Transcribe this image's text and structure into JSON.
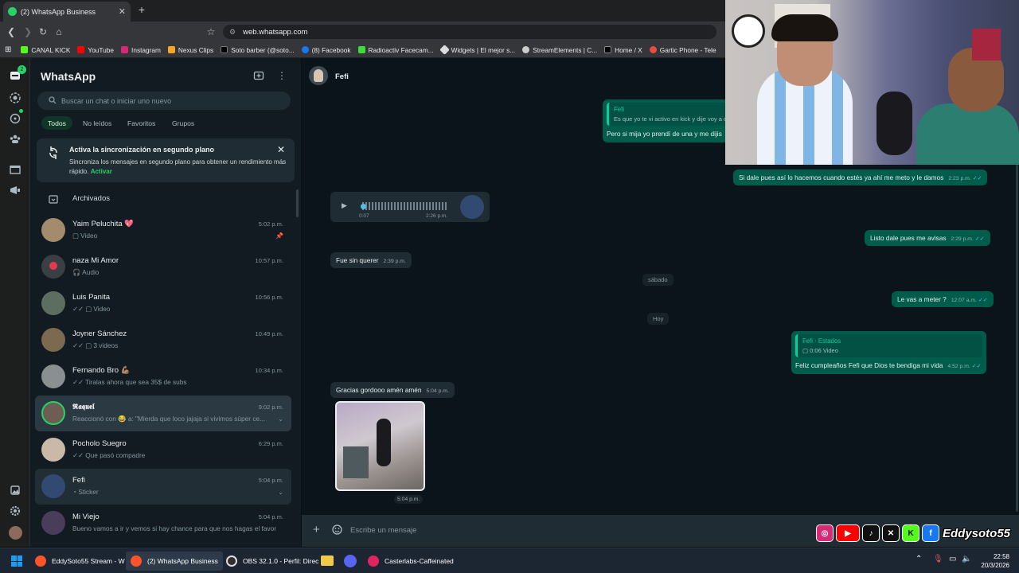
{
  "browser": {
    "tab_title": "(2) WhatsApp Business",
    "url": "web.whatsapp.com",
    "bookmarks": [
      "CANAL KICK",
      "YouTube",
      "Instagram",
      "Nexus Clips",
      "Soto barber (@soto...",
      "(8) Facebook",
      "Radioactiv Facecam...",
      "Widgets | El mejor s...",
      "StreamElements | C...",
      "Home / X",
      "Gartic Phone - Tele"
    ]
  },
  "rail": {
    "badge": "2"
  },
  "sidebar": {
    "title": "WhatsApp",
    "search_placeholder": "Buscar un chat o iniciar uno nuevo",
    "filters": [
      "Todos",
      "No leídos",
      "Favoritos",
      "Grupos"
    ],
    "sync_title": "Activa la sincronización en segundo plano",
    "sync_body": "Sincroniza los mensajes en segundo plano para obtener un rendimiento más rápido.",
    "sync_link": "Activar",
    "archived": "Archivados",
    "chats": [
      {
        "name": "Yaim Peluchita 💖",
        "preview": "▢ Video",
        "time": "5:02 p.m."
      },
      {
        "name": "naza Mi Amor",
        "preview": "🎧 Audio",
        "time": "10:57 p.m."
      },
      {
        "name": "Luis Panita",
        "preview": "✓✓ ▢ Video",
        "time": "10:56 p.m."
      },
      {
        "name": "Joyner Sánchez",
        "preview": "✓✓ ▢ 3 videos",
        "time": "10:49 p.m."
      },
      {
        "name": "Fernando Bro 💪🏽",
        "preview": "✓✓ Tiralas ahora que sea 35$ de subs",
        "time": "10:34 p.m."
      },
      {
        "name": "𝕽𝖆𝖖𝖚𝖊𝖑",
        "preview": "Reaccionó con 😂 a: \"Mierda que loco jajaja si vivimos súper ce...",
        "time": "9:02 p.m."
      },
      {
        "name": "Pocholo Suegro",
        "preview": "✓✓ Que pasó compadre",
        "time": "6:29 p.m."
      },
      {
        "name": "Fefi",
        "preview": "◔ Sticker",
        "time": "5:04 p.m."
      },
      {
        "name": "Mi Viejo",
        "preview": "Bueno vamos a ir y vemos si hay chance para que nos hagas el favor",
        "time": "5:04 p.m."
      }
    ]
  },
  "chat": {
    "contact": "Fefi",
    "quote_name": "Fefi",
    "quote_text": "Es que yo te vi activo en kick y dije voy a d",
    "msg_reply": "Pero si mija yo prendí de una y me dijis",
    "msg_out1": "Si dale pues así lo hacemos cuando estés ya ahí me meto y le damos",
    "msg_out1_time": "2:23 p.m.",
    "audio_duration": "0:07",
    "audio_time": "2:26 p.m.",
    "msg_in1": "Fue sin querer",
    "msg_in1_time": "2:39 p.m.",
    "msg_out2": "Listo dale pues me avisas",
    "msg_out2_time": "2:29 p.m.",
    "day1": "sábado",
    "msg_out3": "Le vas a meter ?",
    "msg_out3_time": "12:07 a.m.",
    "day2": "Hoy",
    "status_quote_name": "Fefi · Estados",
    "status_quote_text": "0:06 Video",
    "msg_out4": "Feliz cumpleaños Fefi que Dios te bendiga mi vida",
    "msg_out4_time": "4:52 p.m.",
    "msg_in2": "Gracias gordooo amén amén",
    "msg_in2_time": "5:04 p.m.",
    "sticker_time": "5:04 p.m.",
    "composer_placeholder": "Escribe un mensaje"
  },
  "overlay": {
    "brand": "Eddysoto55"
  },
  "taskbar": {
    "items": [
      "EddySoto55 Stream - W",
      "(2) WhatsApp Business",
      "OBS 32.1.0 - Perfil: Direc",
      "Casterlabs-Caffeinated"
    ],
    "time": "22:58",
    "date": "20/3/2026"
  }
}
